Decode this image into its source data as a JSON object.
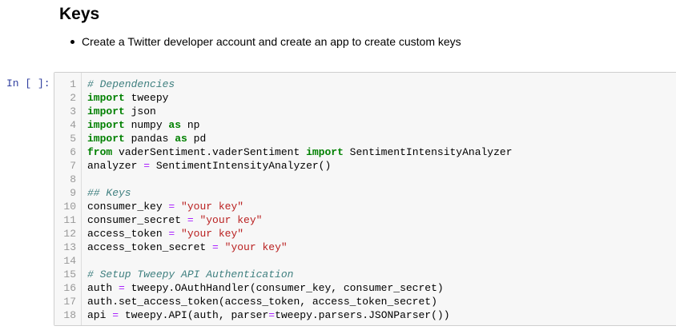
{
  "colors": {
    "prompt": "#303f9f",
    "code_background": "#f7f7f7",
    "code_border": "#cfcfcf",
    "comment": "#408080",
    "keyword": "#008000",
    "string": "#ba2121",
    "operator": "#aa22ff",
    "line_number": "#999999"
  },
  "markdown_cell": {
    "heading": "Keys",
    "bullets": [
      "Create a Twitter developer account and create an app to create custom keys"
    ]
  },
  "code_cell": {
    "prompt": "In [ ]:",
    "lines": [
      {
        "number": "1",
        "tokens": [
          {
            "t": "comment",
            "v": "# Dependencies"
          }
        ]
      },
      {
        "number": "2",
        "tokens": [
          {
            "t": "keyword",
            "v": "import"
          },
          {
            "t": "name",
            "v": " tweepy"
          }
        ]
      },
      {
        "number": "3",
        "tokens": [
          {
            "t": "keyword",
            "v": "import"
          },
          {
            "t": "name",
            "v": " json"
          }
        ]
      },
      {
        "number": "4",
        "tokens": [
          {
            "t": "keyword",
            "v": "import"
          },
          {
            "t": "name",
            "v": " numpy "
          },
          {
            "t": "keyword",
            "v": "as"
          },
          {
            "t": "name",
            "v": " np"
          }
        ]
      },
      {
        "number": "5",
        "tokens": [
          {
            "t": "keyword",
            "v": "import"
          },
          {
            "t": "name",
            "v": " pandas "
          },
          {
            "t": "keyword",
            "v": "as"
          },
          {
            "t": "name",
            "v": " pd"
          }
        ]
      },
      {
        "number": "6",
        "tokens": [
          {
            "t": "keyword",
            "v": "from"
          },
          {
            "t": "name",
            "v": " vaderSentiment.vaderSentiment "
          },
          {
            "t": "keyword",
            "v": "import"
          },
          {
            "t": "name",
            "v": " SentimentIntensityAnalyzer"
          }
        ]
      },
      {
        "number": "7",
        "tokens": [
          {
            "t": "name",
            "v": "analyzer "
          },
          {
            "t": "operator",
            "v": "="
          },
          {
            "t": "name",
            "v": " SentimentIntensityAnalyzer()"
          }
        ]
      },
      {
        "number": "8",
        "tokens": []
      },
      {
        "number": "9",
        "tokens": [
          {
            "t": "comment",
            "v": "## Keys"
          }
        ]
      },
      {
        "number": "10",
        "tokens": [
          {
            "t": "name",
            "v": "consumer_key "
          },
          {
            "t": "operator",
            "v": "="
          },
          {
            "t": "name",
            "v": " "
          },
          {
            "t": "string",
            "v": "\"your key\""
          }
        ]
      },
      {
        "number": "11",
        "tokens": [
          {
            "t": "name",
            "v": "consumer_secret "
          },
          {
            "t": "operator",
            "v": "="
          },
          {
            "t": "name",
            "v": " "
          },
          {
            "t": "string",
            "v": "\"your key\""
          }
        ]
      },
      {
        "number": "12",
        "tokens": [
          {
            "t": "name",
            "v": "access_token "
          },
          {
            "t": "operator",
            "v": "="
          },
          {
            "t": "name",
            "v": " "
          },
          {
            "t": "string",
            "v": "\"your key\""
          }
        ]
      },
      {
        "number": "13",
        "tokens": [
          {
            "t": "name",
            "v": "access_token_secret "
          },
          {
            "t": "operator",
            "v": "="
          },
          {
            "t": "name",
            "v": " "
          },
          {
            "t": "string",
            "v": "\"your key\""
          }
        ]
      },
      {
        "number": "14",
        "tokens": []
      },
      {
        "number": "15",
        "tokens": [
          {
            "t": "comment",
            "v": "# Setup Tweepy API Authentication"
          }
        ]
      },
      {
        "number": "16",
        "tokens": [
          {
            "t": "name",
            "v": "auth "
          },
          {
            "t": "operator",
            "v": "="
          },
          {
            "t": "name",
            "v": " tweepy.OAuthHandler(consumer_key, consumer_secret)"
          }
        ]
      },
      {
        "number": "17",
        "tokens": [
          {
            "t": "name",
            "v": "auth.set_access_token(access_token, access_token_secret)"
          }
        ]
      },
      {
        "number": "18",
        "tokens": [
          {
            "t": "name",
            "v": "api "
          },
          {
            "t": "operator",
            "v": "="
          },
          {
            "t": "name",
            "v": " tweepy.API(auth, parser"
          },
          {
            "t": "operator",
            "v": "="
          },
          {
            "t": "name",
            "v": "tweepy.parsers.JSONParser())"
          }
        ]
      }
    ]
  }
}
